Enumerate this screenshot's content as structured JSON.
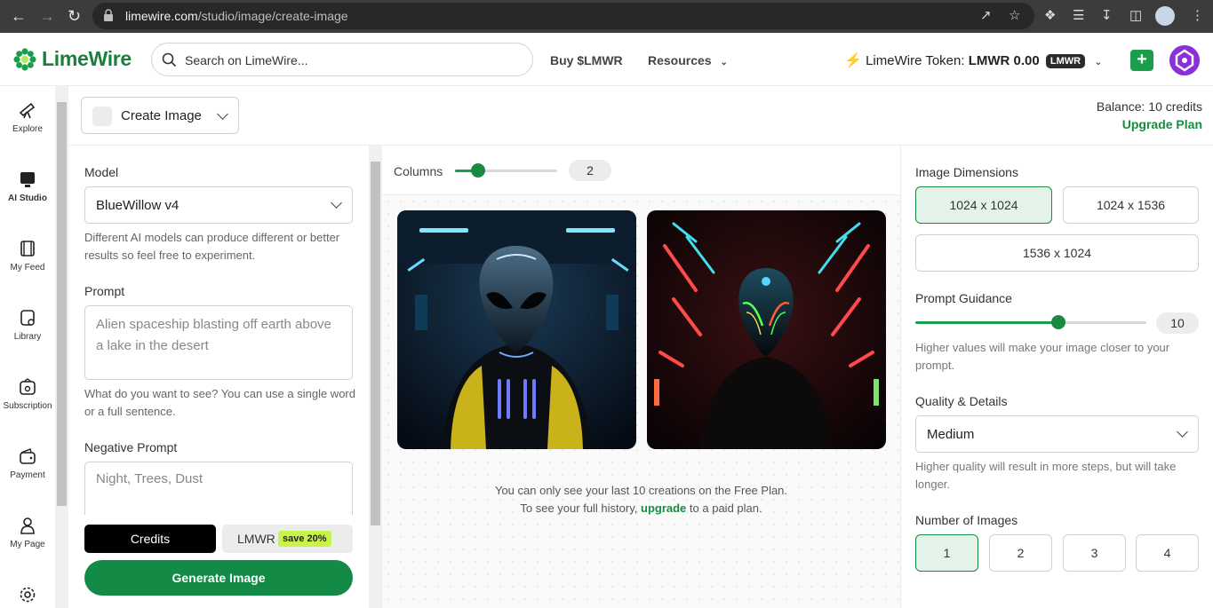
{
  "browser": {
    "url_host": "limewire.com",
    "url_path": "/studio/image/create-image"
  },
  "header": {
    "brand": "LimeWire",
    "search_placeholder": "Search on LimeWire...",
    "nav": [
      "Buy $LMWR",
      "Resources"
    ],
    "token_label": "LimeWire Token:",
    "token_value": "LMWR 0.00",
    "token_badge": "LMWR"
  },
  "sidebar": {
    "items": [
      {
        "label": "Explore",
        "icon": "telescope-icon"
      },
      {
        "label": "AI Studio",
        "icon": "studio-icon"
      },
      {
        "label": "My Feed",
        "icon": "feed-icon"
      },
      {
        "label": "Library",
        "icon": "library-icon"
      },
      {
        "label": "Subscription",
        "icon": "subscription-icon"
      },
      {
        "label": "Payment",
        "icon": "wallet-icon"
      },
      {
        "label": "My Page",
        "icon": "user-icon"
      }
    ]
  },
  "toolbar": {
    "create_label": "Create Image",
    "balance": "Balance: 10 credits",
    "upgrade": "Upgrade Plan"
  },
  "left_panel": {
    "model_label": "Model",
    "model_value": "BlueWillow v4",
    "model_hint": "Different AI models can produce different or better results so feel free to experiment.",
    "prompt_label": "Prompt",
    "prompt_value": "Alien spaceship blasting off earth above a lake in the desert",
    "prompt_hint": "What do you want to see? You can use a single word or a full sentence.",
    "negative_label": "Negative Prompt",
    "negative_value": "Night, Trees, Dust",
    "credits_tab": "Credits",
    "lmwr_tab": "LMWR",
    "save_badge": "save 20%",
    "generate": "Generate Image"
  },
  "center": {
    "columns_label": "Columns",
    "columns_value": "2",
    "columns_fraction": 0.23,
    "note_line1": "You can only see your last 10 creations on the Free Plan.",
    "note_line2_pre": "To see your full history,",
    "note_link": "upgrade",
    "note_line2_post": "to a paid plan."
  },
  "right_panel": {
    "dimensions_label": "Image Dimensions",
    "dimensions": [
      "1024 x 1024",
      "1024 x 1536",
      "1536 x 1024"
    ],
    "dimensions_selected": 0,
    "guidance_label": "Prompt Guidance",
    "guidance_value": "10",
    "guidance_fraction": 0.62,
    "guidance_hint": "Higher values will make your image closer to your prompt.",
    "quality_label": "Quality & Details",
    "quality_value": "Medium",
    "quality_hint": "Higher quality will result in more steps, but will take longer.",
    "num_images_label": "Number of Images",
    "num_images": [
      "1",
      "2",
      "3",
      "4"
    ],
    "num_images_selected": 0
  },
  "colors": {
    "brand_green": "#1a8a42",
    "selected_bg": "#e4f3ea",
    "save_badge": "#c9f34a"
  }
}
